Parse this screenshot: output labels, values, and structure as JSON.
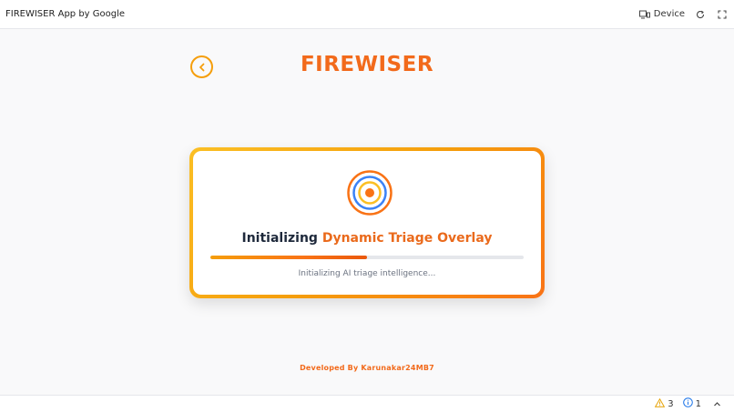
{
  "topbar": {
    "app_title": "FIREWISER App by Google",
    "device_label": "Device",
    "icons": [
      "device-icon",
      "refresh-icon",
      "fullscreen-icon"
    ]
  },
  "header": {
    "brand": "FIREWISER",
    "back_icon": "chevron-left-icon"
  },
  "loading_card": {
    "title_plain": "Initializing",
    "title_accent": "Dynamic Triage Overlay",
    "progress_percent": 50,
    "subtitle": "Initializing AI triage intelligence..."
  },
  "footer": {
    "credit": "Developed By Karunakar24MB7"
  },
  "bottombar": {
    "warning_count": "3",
    "info_count": "1",
    "icons": [
      "warning-icon",
      "info-icon",
      "chevron-up-icon"
    ]
  },
  "colors": {
    "brand": "#f26a1b",
    "accent": "#ea6a1c",
    "border_gold": "#f59e0b",
    "radar_outer": "#f97316",
    "radar_mid": "#3b82f6",
    "radar_inner": "#fbbf24",
    "radar_core": "#f97316"
  }
}
